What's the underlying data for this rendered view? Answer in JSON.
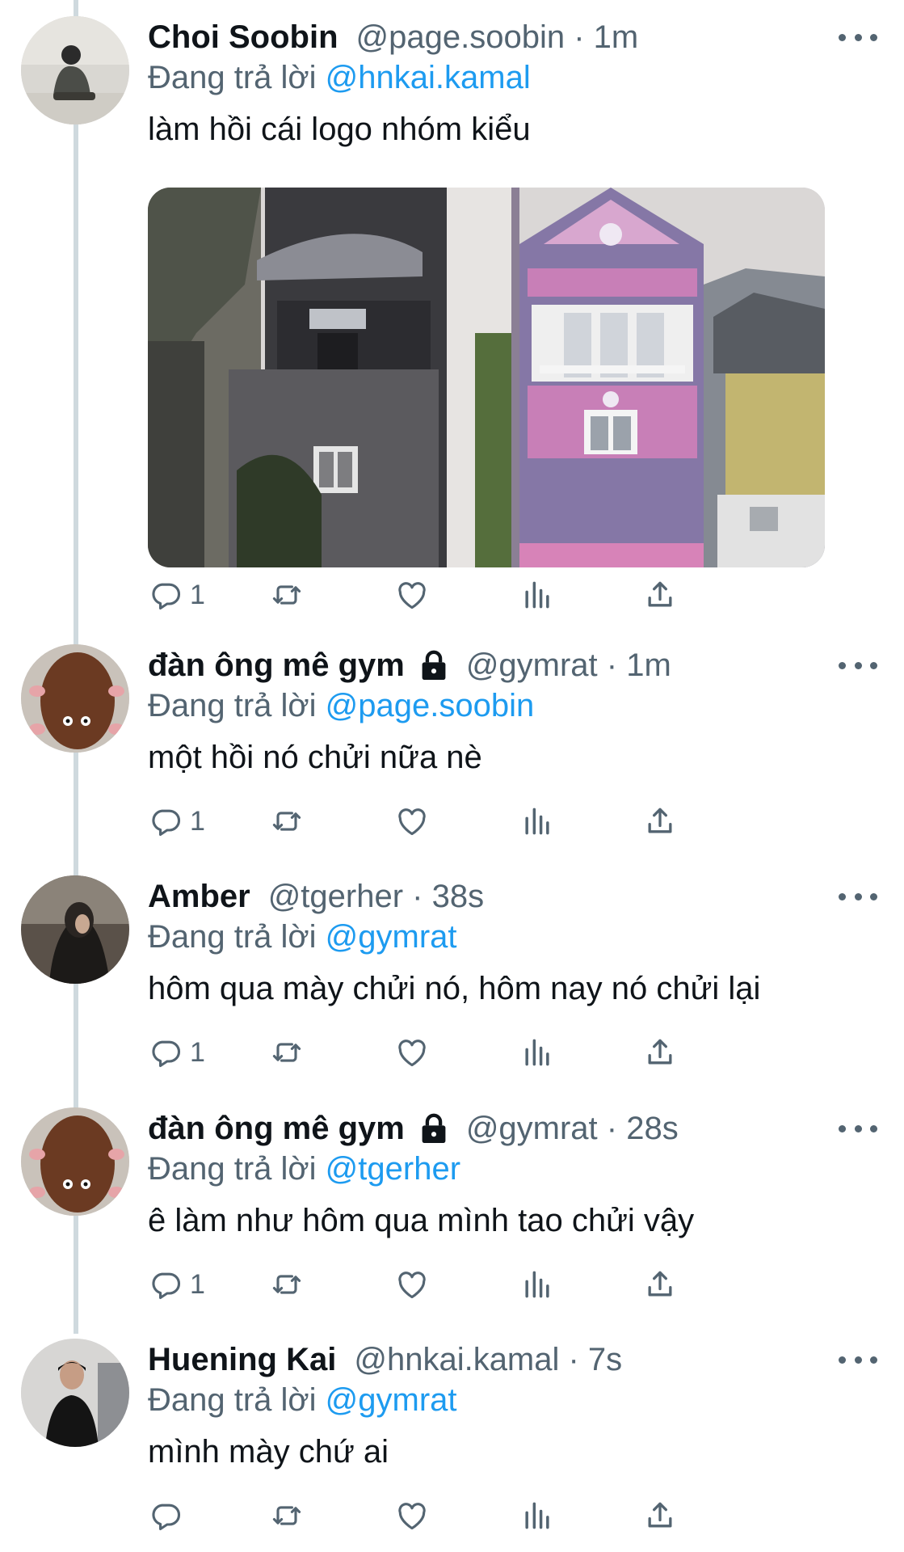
{
  "tweets": [
    {
      "name": "Choi Soobin",
      "handle_time": "@page.soobin · 1m",
      "replying_prefix": "Đang trả lời",
      "replying_to": "@hnkai.kamal",
      "text": "làm hồi cái logo nhóm kiểu",
      "reply_count": "1",
      "has_lock": false,
      "has_media": true
    },
    {
      "name": "đàn ông mê gym",
      "handle_time": "@gymrat · 1m",
      "replying_prefix": "Đang trả lời",
      "replying_to": "@page.soobin",
      "text": "một hồi nó chửi nữa nè",
      "reply_count": "1",
      "has_lock": true
    },
    {
      "name": "Amber",
      "handle_time": "@tgerher · 38s",
      "replying_prefix": "Đang trả lời",
      "replying_to": "@gymrat",
      "text": "hôm qua mày chửi nó, hôm nay nó chửi lại",
      "reply_count": "1",
      "has_lock": false
    },
    {
      "name": "đàn ông mê gym",
      "handle_time": "@gymrat · 28s",
      "replying_prefix": "Đang trả lời",
      "replying_to": "@tgerher",
      "text": "ê làm như hôm qua mình tao chửi vậy",
      "reply_count": "1",
      "has_lock": true
    },
    {
      "name": "Huening Kai",
      "handle_time": "@hnkai.kamal · 7s",
      "replying_prefix": "Đang trả lời",
      "replying_to": "@gymrat",
      "text": "mình mày chứ ai",
      "reply_count": "",
      "has_lock": false
    }
  ],
  "icons": {
    "reply": "reply-icon",
    "retweet": "retweet-icon",
    "like": "like-icon",
    "views": "views-icon",
    "share": "share-icon",
    "more": "more-icon",
    "lock": "lock-icon"
  },
  "colors": {
    "link": "#1d9bf0",
    "secondary_text": "#536471",
    "primary_text": "#0f1419",
    "thread_line": "#cfd9de"
  }
}
